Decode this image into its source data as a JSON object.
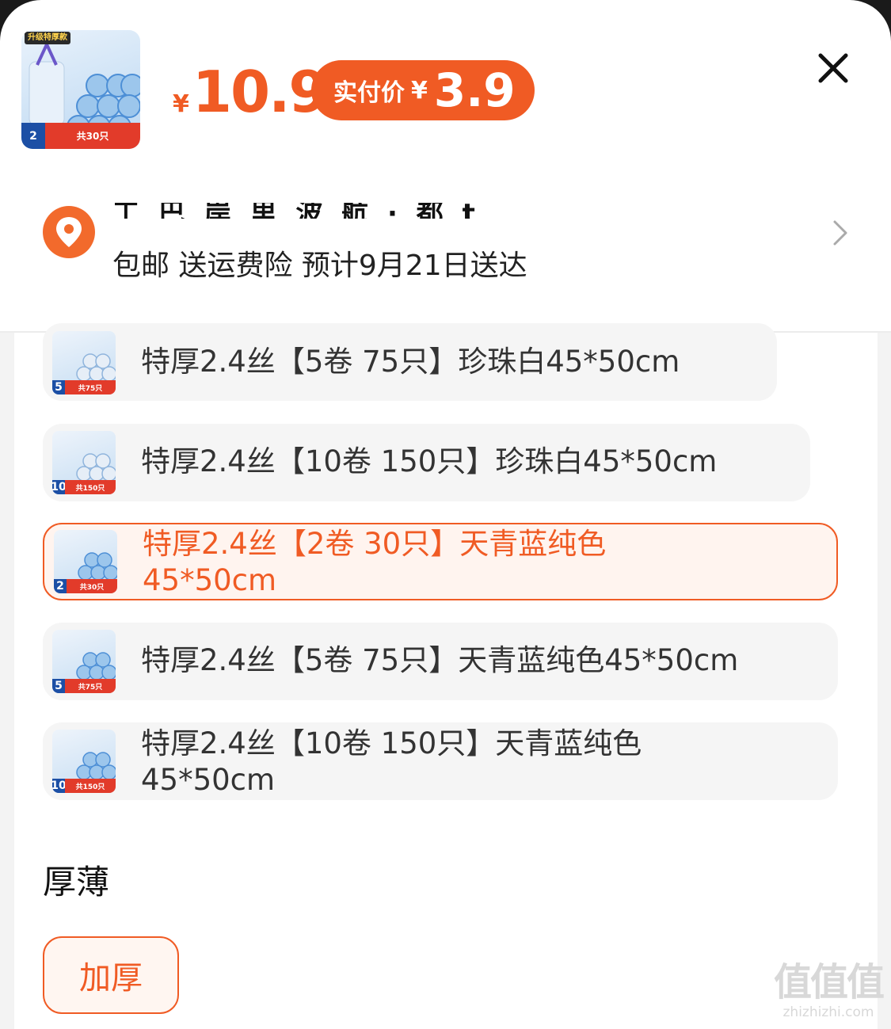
{
  "product": {
    "thumb_badge": "升级特厚款",
    "thumb_count": "共30只",
    "thumb_roll_num": "2"
  },
  "price": {
    "currency": "¥",
    "original": "10.9",
    "paid_label": "实付价",
    "paid_currency": "¥",
    "paid_value": "3.9"
  },
  "shipping": {
    "address_obscured": "工 巴 岸  里 波 航  · 都 t",
    "info": "包邮 送运费险 预计9月21日送达"
  },
  "options": [
    {
      "label": "特厚2.4丝【5卷 75只】珍珠白45*50cm",
      "count": "共75只",
      "num": "5",
      "selected": false
    },
    {
      "label": "特厚2.4丝【10卷 150只】珍珠白45*50cm",
      "count": "共150只",
      "num": "10",
      "selected": false
    },
    {
      "label_line1": "特厚2.4丝【2卷 30只】天青蓝纯色",
      "label_line2": "45*50cm",
      "count": "共30只",
      "num": "2",
      "selected": true
    },
    {
      "label": "特厚2.4丝【5卷 75只】天青蓝纯色45*50cm",
      "count": "共75只",
      "num": "5",
      "selected": false
    },
    {
      "label_line1": "特厚2.4丝【10卷 150只】天青蓝纯色",
      "label_line2": "45*50cm",
      "count": "共150只",
      "num": "10",
      "selected": false
    }
  ],
  "thickness": {
    "title": "厚薄",
    "option": "加厚"
  },
  "watermark": {
    "main": "值值值",
    "site": "zhizhizhi.com"
  },
  "colors": {
    "accent": "#f05b24",
    "selected_bg": "#fff4ef",
    "option_bg": "#f5f5f5"
  },
  "icons": {
    "close": "close-icon",
    "location": "location-pin-icon",
    "chevron": "chevron-right-icon"
  }
}
